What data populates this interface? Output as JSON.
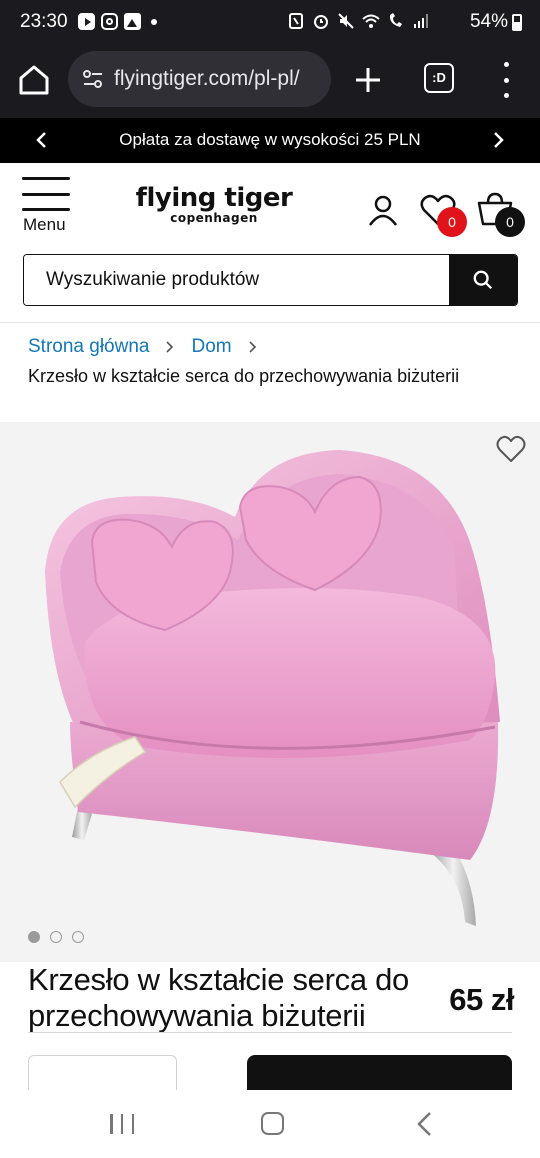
{
  "status_bar": {
    "time": "23:30",
    "battery": "54%"
  },
  "browser": {
    "url": "flyingtiger.com/pl-pl/",
    "tabs_label": ":D"
  },
  "promo": {
    "text": "Opłata za dostawę w wysokości 25 PLN"
  },
  "header": {
    "menu_label": "Menu",
    "logo_main": "flying tiger",
    "logo_sub": "copenhagen",
    "wishlist_count": "0",
    "cart_count": "0",
    "search_placeholder": "Wyszukiwanie produktów"
  },
  "breadcrumb": {
    "items": [
      "Strona główna",
      "Dom"
    ],
    "current": "Krzesło w kształcie serca do przechowywania biżuterii"
  },
  "product": {
    "title": "Krzesło w kształcie serca do przechowywania biżuterii",
    "price": "65 zł",
    "gallery_total": 3,
    "gallery_active": 1
  },
  "colors": {
    "link": "#1377b9",
    "badge_red": "#e0121a",
    "chair_pink": "#e79ac8"
  }
}
